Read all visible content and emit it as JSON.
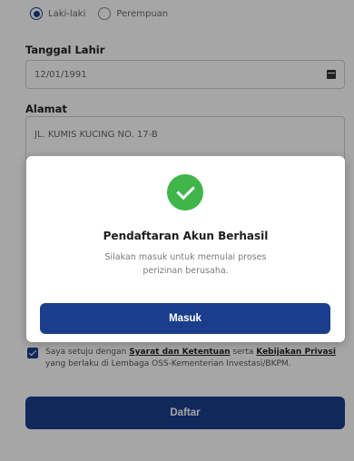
{
  "gender": {
    "options": [
      {
        "label": "Laki-laki",
        "selected": true
      },
      {
        "label": "Perempuan",
        "selected": false
      }
    ]
  },
  "birthdate": {
    "label": "Tanggal Lahir",
    "value": "12/01/1991"
  },
  "address": {
    "label": "Alamat",
    "value": "JL. KUMIS KUCING NO. 17-B"
  },
  "consent": {
    "checked": true,
    "text_before": "Saya setuju dengan ",
    "terms_link": "Syarat dan Ketentuan",
    "text_middle": " serta ",
    "privacy_link": "Kebijakan Privasi",
    "text_after": " yang berlaku di Lembaga OSS-Kementerian Investasi/BKPM."
  },
  "register_button": "Daftar",
  "modal": {
    "icon": "check-circle-icon",
    "title": "Pendaftaran Akun Berhasil",
    "description": "Silakan masuk untuk memulai proses perizinan berusaha.",
    "button": "Masuk"
  },
  "colors": {
    "primary": "#1a3e8c",
    "success": "#3fb54a"
  }
}
